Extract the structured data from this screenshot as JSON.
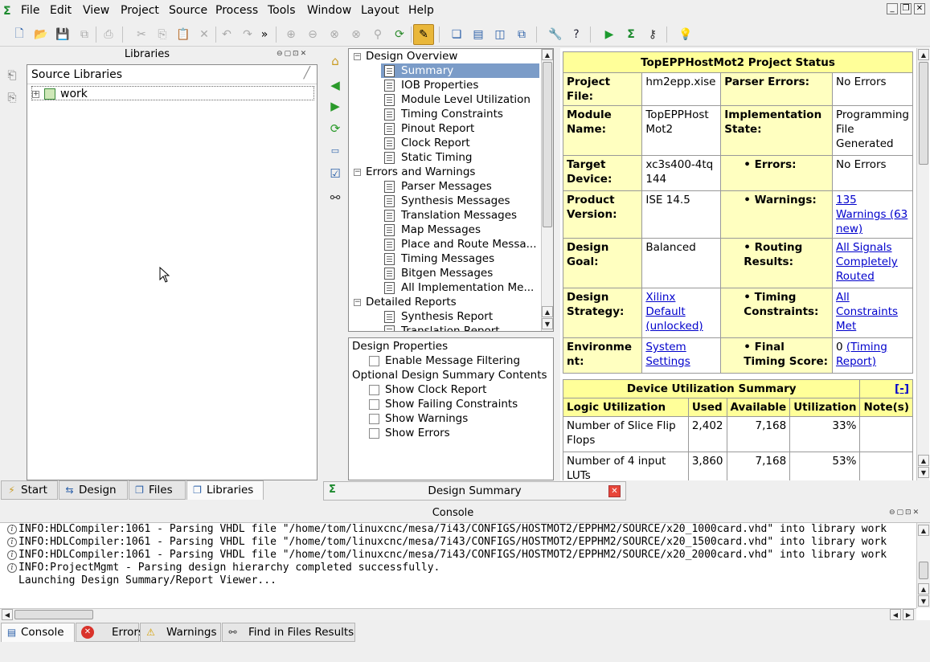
{
  "menubar": {
    "items": [
      "File",
      "Edit",
      "View",
      "Project",
      "Source",
      "Process",
      "Tools",
      "Window",
      "Layout",
      "Help"
    ]
  },
  "libraries_panel": {
    "title": "Libraries",
    "header": "Source Libraries",
    "items": [
      {
        "label": "work"
      }
    ]
  },
  "left_tabs": [
    {
      "label": "Start",
      "icon": "start-icon"
    },
    {
      "label": "Design",
      "icon": "design-icon"
    },
    {
      "label": "Files",
      "icon": "files-icon"
    },
    {
      "label": "Libraries",
      "icon": "libraries-icon",
      "active": true
    }
  ],
  "nav_tree": {
    "sections": [
      {
        "label": "Design Overview",
        "items": [
          "Summary",
          "IOB Properties",
          "Module Level Utilization",
          "Timing Constraints",
          "Pinout Report",
          "Clock Report",
          "Static Timing"
        ]
      },
      {
        "label": "Errors and Warnings",
        "items": [
          "Parser Messages",
          "Synthesis Messages",
          "Translation Messages",
          "Map Messages",
          "Place and Route Messa...",
          "Timing Messages",
          "Bitgen Messages",
          "All Implementation Me..."
        ]
      },
      {
        "label": "Detailed Reports",
        "items": [
          "Synthesis Report",
          "Translation Report"
        ]
      }
    ],
    "selected": "Summary"
  },
  "design_properties": {
    "title": "Design Properties",
    "enable_filtering": "Enable Message Filtering",
    "optional_title": "Optional Design Summary Contents",
    "options": [
      "Show Clock Report",
      "Show Failing Constraints",
      "Show Warnings",
      "Show Errors"
    ]
  },
  "project_status": {
    "title": "TopEPPHostMot2 Project Status",
    "project_file_label": "Project File:",
    "project_file": "hm2epp.xise",
    "parser_errors_label": "Parser Errors:",
    "parser_errors": "No Errors",
    "module_name_label": "Module Name:",
    "module_name": "TopEPPHostMot2",
    "impl_state_label": "Implementation State:",
    "impl_state": "Programming File Generated",
    "target_device_label": "Target Device:",
    "target_device": "xc3s400-4tq144",
    "errors_label": "Errors:",
    "errors": "No Errors",
    "product_version_label": "Product Version:",
    "product_version": "ISE 14.5",
    "warnings_label": "Warnings:",
    "warnings": "135 Warnings (63 new)",
    "design_goal_label": "Design Goal:",
    "design_goal": "Balanced",
    "routing_label": "Routing Results:",
    "routing": "All Signals Completely Routed",
    "design_strategy_label": "Design Strategy:",
    "design_strategy": "Xilinx Default (unlocked)",
    "timing_constraints_label": "Timing Constraints:",
    "timing_constraints": "All Constraints Met",
    "environment_label": "Environment:",
    "environment": "System Settings",
    "final_timing_label": "Final Timing Score:",
    "final_timing_value": "0",
    "final_timing_link": "(Timing Report)"
  },
  "device_utilization": {
    "title": "Device Utilization Summary",
    "collapse": "[-]",
    "headers": [
      "Logic Utilization",
      "Used",
      "Available",
      "Utilization",
      "Note(s)"
    ],
    "rows": [
      {
        "name": "Number of Slice Flip Flops",
        "used": "2,402",
        "available": "7,168",
        "util": "33%",
        "note": ""
      },
      {
        "name": "Number of 4 input LUTs",
        "used": "3,860",
        "available": "7,168",
        "util": "53%",
        "note": ""
      }
    ]
  },
  "design_summary_tab": {
    "label": "Design Summary"
  },
  "console": {
    "title": "Console",
    "lines": [
      {
        "icon": true,
        "text": "INFO:HDLCompiler:1061 - Parsing VHDL file \"/home/tom/linuxcnc/mesa/7i43/CONFIGS/HOSTMOT2/EPPHM2/SOURCE/x20_1000card.vhd\" into library work"
      },
      {
        "icon": true,
        "text": "INFO:HDLCompiler:1061 - Parsing VHDL file \"/home/tom/linuxcnc/mesa/7i43/CONFIGS/HOSTMOT2/EPPHM2/SOURCE/x20_1500card.vhd\" into library work"
      },
      {
        "icon": true,
        "text": "INFO:HDLCompiler:1061 - Parsing VHDL file \"/home/tom/linuxcnc/mesa/7i43/CONFIGS/HOSTMOT2/EPPHM2/SOURCE/x20_2000card.vhd\" into library work"
      },
      {
        "icon": true,
        "text": "INFO:ProjectMgmt - Parsing design hierarchy completed successfully."
      },
      {
        "icon": false,
        "text": "Launching Design Summary/Report Viewer..."
      }
    ]
  },
  "bottom_tabs": [
    {
      "label": "Console",
      "icon": "console-icon",
      "active": true
    },
    {
      "label": "Errors",
      "icon": "error-icon"
    },
    {
      "label": "Warnings",
      "icon": "warning-icon"
    },
    {
      "label": "Find in Files Results",
      "icon": "binoculars-icon"
    }
  ]
}
